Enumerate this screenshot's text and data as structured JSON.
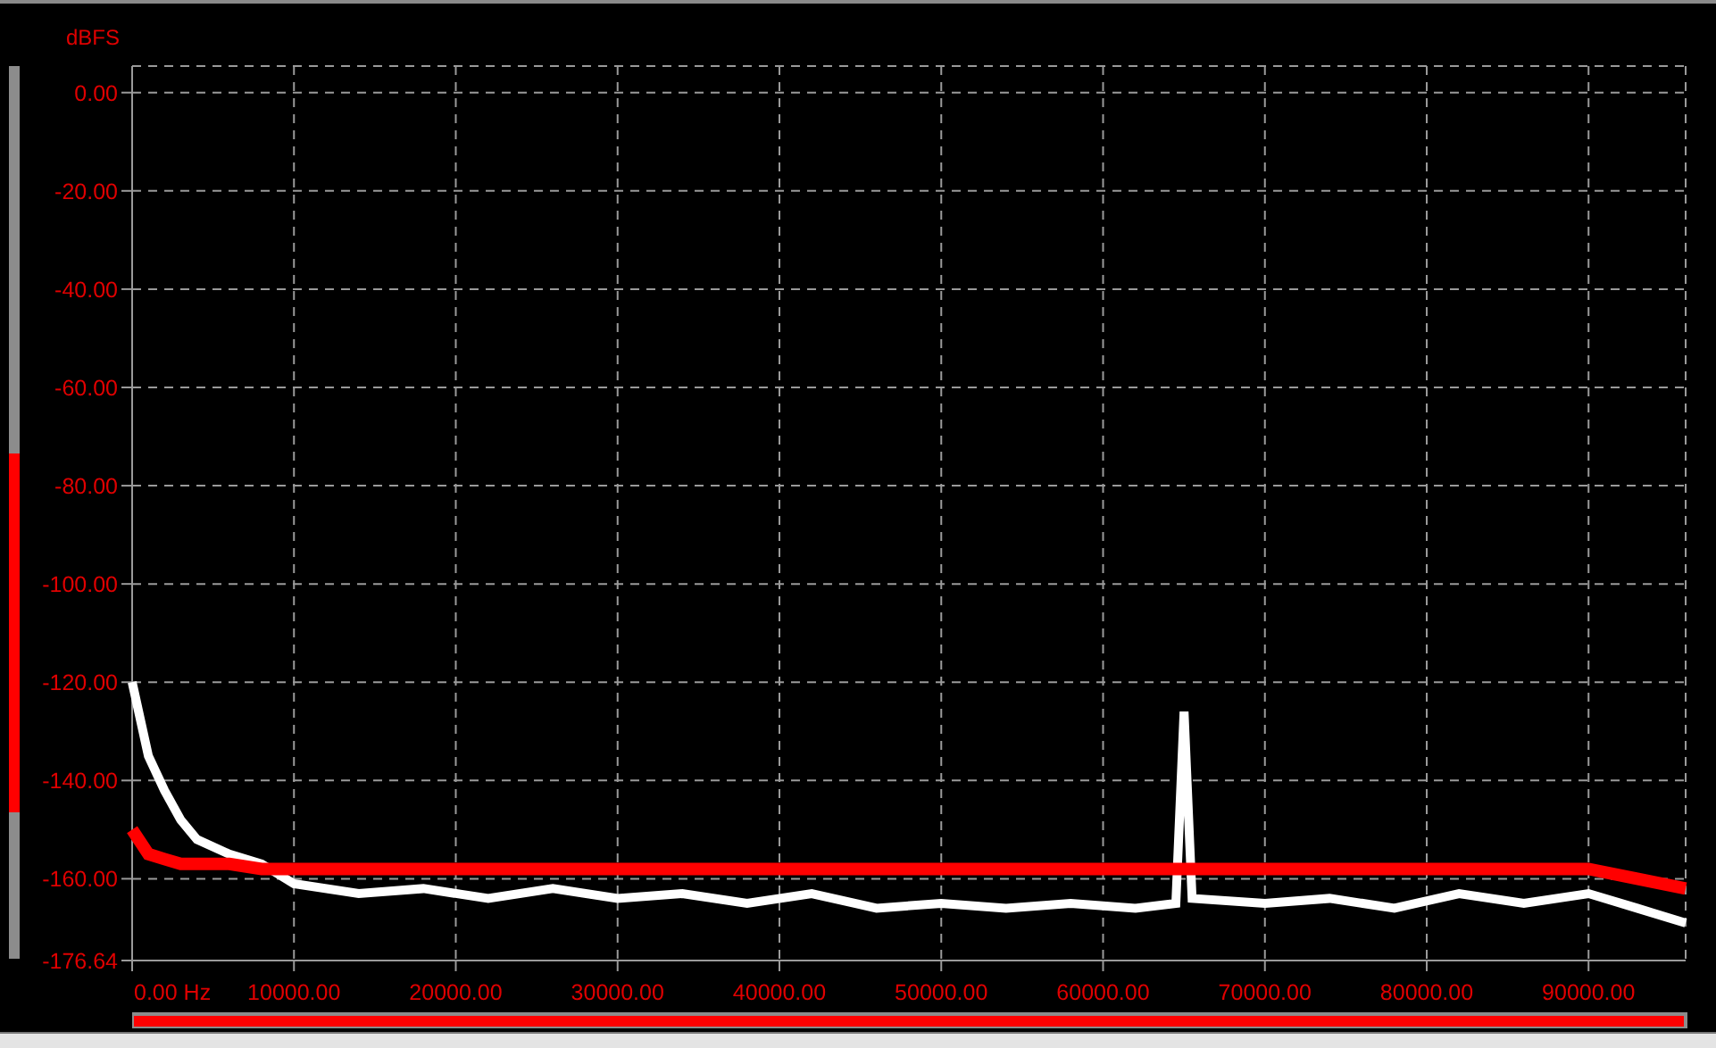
{
  "chart_data": {
    "type": "line",
    "grid": true,
    "ylabel": "dBFS",
    "xlim": [
      0,
      96000
    ],
    "ylim": [
      -176.64,
      5.4
    ],
    "yticks": [
      {
        "value": 0,
        "label": "0.00"
      },
      {
        "value": -20,
        "label": "-20.00"
      },
      {
        "value": -40,
        "label": "-40.00"
      },
      {
        "value": -60,
        "label": "-60.00"
      },
      {
        "value": -80,
        "label": "-80.00"
      },
      {
        "value": -100,
        "label": "-100.00"
      },
      {
        "value": -120,
        "label": "-120.00"
      },
      {
        "value": -140,
        "label": "-140.00"
      },
      {
        "value": -160,
        "label": "-160.00"
      },
      {
        "value": -176.64,
        "label": "-176.64"
      }
    ],
    "xticks": [
      {
        "value": 0,
        "label": "0.00 Hz"
      },
      {
        "value": 10000,
        "label": "10000.00"
      },
      {
        "value": 20000,
        "label": "20000.00"
      },
      {
        "value": 30000,
        "label": "30000.00"
      },
      {
        "value": 40000,
        "label": "40000.00"
      },
      {
        "value": 50000,
        "label": "50000.00"
      },
      {
        "value": 60000,
        "label": "60000.00"
      },
      {
        "value": 70000,
        "label": "70000.00"
      },
      {
        "value": 80000,
        "label": "80000.00"
      },
      {
        "value": 90000,
        "label": "90000.00"
      }
    ],
    "x": [
      0,
      1000,
      2000,
      3000,
      4000,
      6000,
      8000,
      10000,
      14000,
      18000,
      22000,
      26000,
      30000,
      34000,
      38000,
      42000,
      46000,
      50000,
      54000,
      58000,
      62000,
      64500,
      65000,
      65500,
      70000,
      74000,
      78000,
      82000,
      86000,
      90000,
      93000,
      96000
    ],
    "series": [
      {
        "color": "#ffffff",
        "values": [
          -120,
          -135,
          -142,
          -148,
          -152,
          -155,
          -157,
          -161,
          -163,
          -162,
          -164,
          -162,
          -164,
          -163,
          -165,
          -163,
          -166,
          -165,
          -166,
          -165,
          -166,
          -165,
          -126,
          -164,
          -165,
          -164,
          -166,
          -163,
          -165,
          -163,
          -166,
          -169
        ]
      },
      {
        "color": "#ff0000",
        "values": [
          -150,
          -155,
          -156,
          -157,
          -157,
          -157,
          -158,
          -158,
          -158,
          -158,
          -158,
          -158,
          -158,
          -158,
          -158,
          -158,
          -158,
          -158,
          -158,
          -158,
          -158,
          -158,
          -158,
          -158,
          -158,
          -158,
          -158,
          -158,
          -158,
          -158,
          -160,
          -162
        ]
      }
    ]
  }
}
